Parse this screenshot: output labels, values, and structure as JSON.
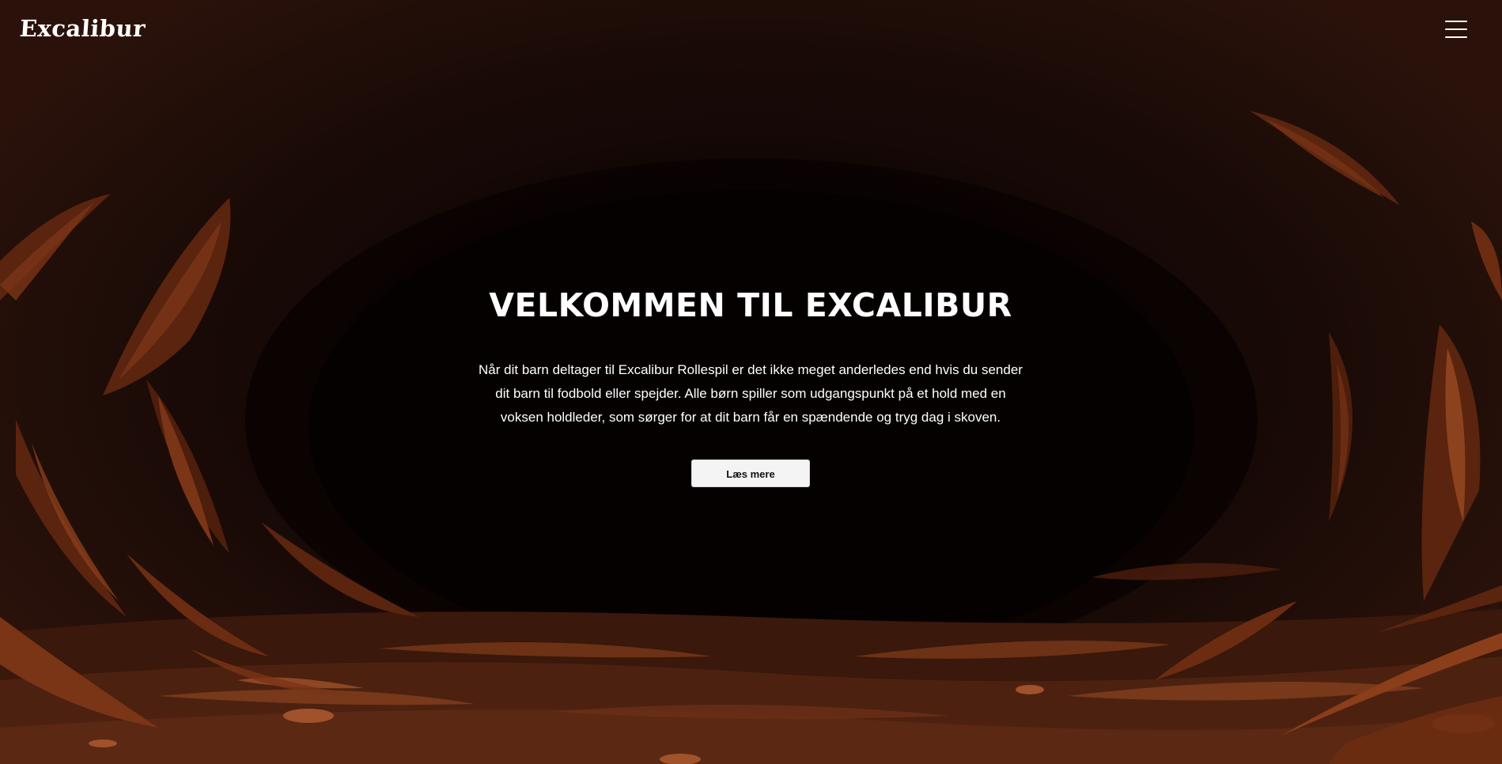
{
  "header": {
    "logo_text": "Excalibur",
    "menu_icon": "hamburger-menu-icon"
  },
  "hero": {
    "title": "VELKOMMEN TIL EXCALIBUR",
    "text": "Når dit barn deltager til Excalibur Rollespil er det ikke meget anderledes end hvis du sender dit barn til fodbold eller spejder. Alle børn spiller som udgangspunkt på et hold med en voksen holdleder, som sørger for at dit barn får en spændende og tryg dag i skoven.",
    "button_label": "Læs mere"
  },
  "colors": {
    "background_dark": "#0d0503",
    "leaf_brown": "#6b2e12",
    "leaf_highlight": "#9a4a22",
    "text": "#ffffff",
    "button_bg": "#f4f4f4"
  }
}
